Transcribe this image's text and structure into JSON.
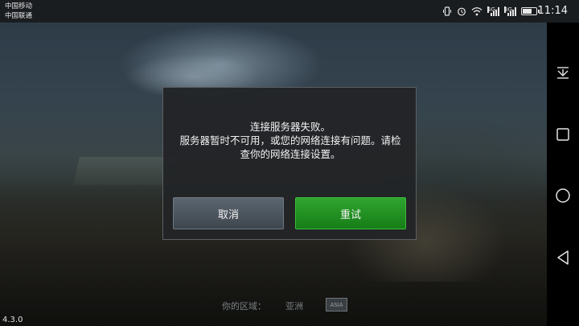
{
  "status_bar": {
    "carrier_1": "中国移动",
    "carrier_2": "中国联通",
    "signal_1_label": "4G",
    "signal_2_label": "3G",
    "time": "11:14",
    "battery_level": 0.7
  },
  "dialog": {
    "message_line_1": "连接服务器失败。",
    "message_line_2": "服务器暂时不可用，或您的网络连接有问题。请检",
    "message_line_3": "查你的网络连接设置。",
    "cancel_label": "取消",
    "retry_label": "重试"
  },
  "footer": {
    "region_label": "你的区域：",
    "region_value": "亚洲",
    "region_badge": "ASIA",
    "version": "4.3.0"
  },
  "colors": {
    "retry_button": "#1f8f20",
    "cancel_button": "#4c555d",
    "dialog_bg": "#222426"
  },
  "nav_bar": {
    "icons": [
      "hide-bar-icon",
      "recent-apps-icon",
      "home-icon",
      "back-icon"
    ]
  }
}
